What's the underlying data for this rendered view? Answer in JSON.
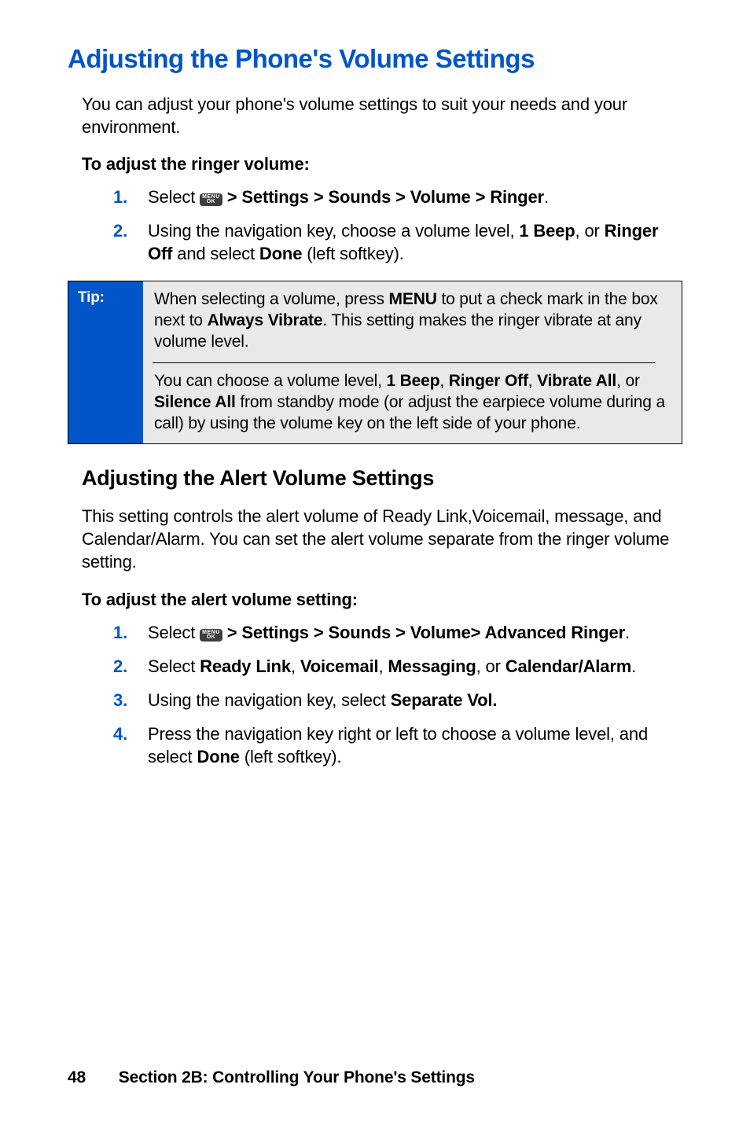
{
  "h1": "Adjusting the Phone's Volume Settings",
  "intro": "You can adjust your phone's volume settings to suit your needs and your environment.",
  "ringer_sub": "To adjust the ringer volume:",
  "menu_icon": {
    "top": "MENU",
    "bot": "OK"
  },
  "step1_prefix": "Select ",
  "step1_path": " > Settings > Sounds > Volume > Ringer",
  "step1_dot": ".",
  "step2_a": "Using the navigation key, choose a volume level, ",
  "step2_b": "1 Beep",
  "step2_c": ", or ",
  "step2_d": "Ringer Off",
  "step2_e": " and select ",
  "step2_f": "Done",
  "step2_g": " (left softkey).",
  "tip_label": "Tip:",
  "tip1_a": "When selecting a volume, press ",
  "tip1_b": "MENU",
  "tip1_c": " to put a check mark in the box next to ",
  "tip1_d": "Always Vibrate",
  "tip1_e": ". This setting makes the ringer vibrate at any volume level.",
  "tip2_a": "You can choose a volume level, ",
  "tip2_b": "1 Beep",
  "tip2_c": ", ",
  "tip2_d": "Ringer Off",
  "tip2_e": ", ",
  "tip2_f": "Vibrate All",
  "tip2_g": ", or ",
  "tip2_h": "Silence All",
  "tip2_i": " from standby mode (or adjust the earpiece volume during a call) by using the volume key on the left side of your phone.",
  "h2": "Adjusting the Alert Volume Settings",
  "alert_intro": "This setting controls the alert volume of Ready Link,Voicemail, message, and Calendar/Alarm. You can set the alert volume separate from the ringer volume setting.",
  "alert_sub": "To adjust the alert volume setting:",
  "a1_prefix": "Select ",
  "a1_path": " > Settings > Sounds > Volume> Advanced Ringer",
  "a1_dot": ".",
  "a2_a": "Select ",
  "a2_b": "Ready Link",
  "a2_c": ", ",
  "a2_d": "Voicemail",
  "a2_e": ", ",
  "a2_f": "Messaging",
  "a2_g": ", or ",
  "a2_h": "Calendar/Alarm",
  "a2_i": ".",
  "a3_a": "Using the navigation key, select ",
  "a3_b": "Separate Vol.",
  "a4_a": "Press the navigation key right or left to choose a volume level, and select ",
  "a4_b": "Done",
  "a4_c": " (left softkey).",
  "footer_page": "48",
  "footer_section": "Section 2B: Controlling Your Phone's Settings",
  "nums": {
    "n1": "1.",
    "n2": "2.",
    "n3": "3.",
    "n4": "4."
  }
}
